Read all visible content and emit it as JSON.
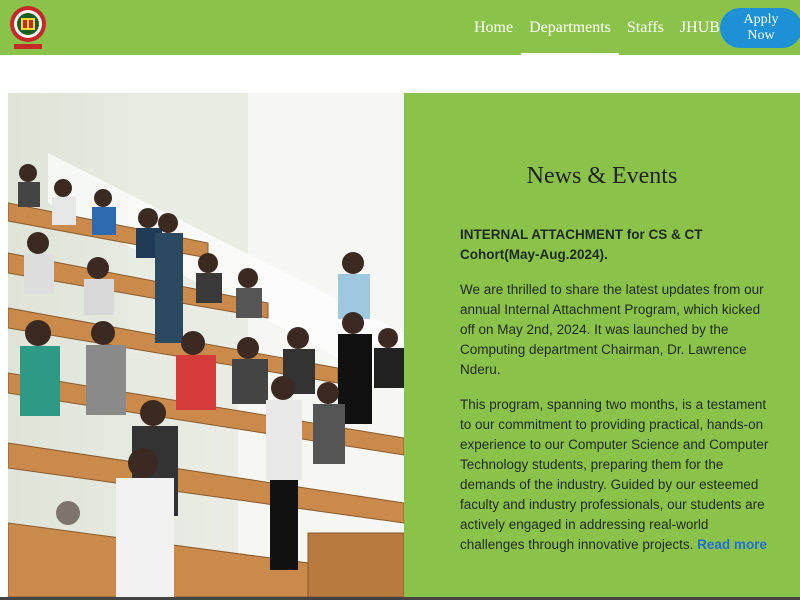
{
  "header": {
    "bg_color": "#8bc34a",
    "logo_icon": "university-crest-icon"
  },
  "nav": {
    "items": [
      {
        "label": "Home"
      },
      {
        "label": "Departments",
        "active": true
      },
      {
        "label": "Staffs"
      },
      {
        "label": "JHUB"
      }
    ],
    "apply_label": "Apply Now",
    "apply_color": "#1e90d6"
  },
  "news": {
    "title": "News & Events",
    "headline": "INTERNAL ATTACHMENT for CS & CT Cohort(May-Aug.2024).",
    "paragraph1": "We are thrilled to share the latest updates from our annual Internal Attachment Program, which kicked off on May 2nd, 2024. It was launched by the Computing department Chairman, Dr. Lawrence Nderu.",
    "paragraph2": "This program, spanning two months, is a testament to our commitment to providing practical, hands-on experience to our Computer Science and Computer Technology students, preparing them for the demands of the industry. Guided by our esteemed faculty and industry professionals, our students are actively engaged in addressing real-world challenges through innovative projects.",
    "read_more": "Read more",
    "panel_color": "#8bc34a"
  }
}
